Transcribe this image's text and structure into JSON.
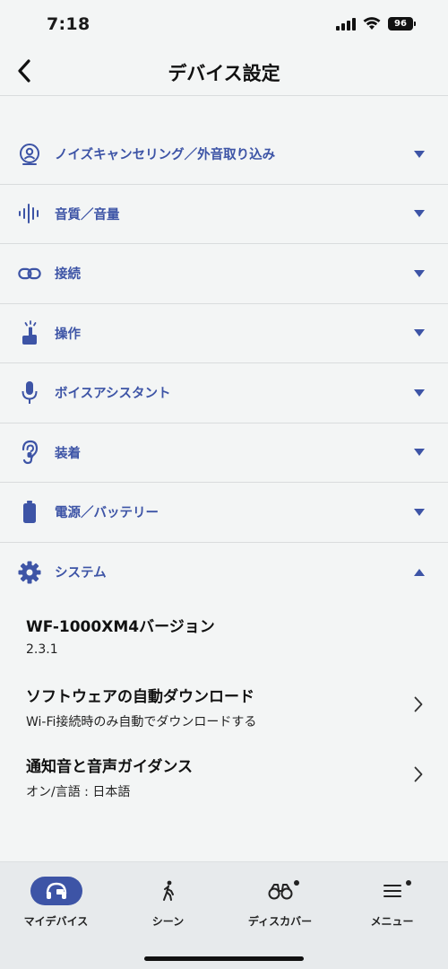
{
  "status_bar": {
    "time": "7:18",
    "battery": "96"
  },
  "header": {
    "title": "デバイス設定"
  },
  "sections": [
    {
      "label": "ノイズキャンセリング／外音取り込み",
      "icon": "ear-person-icon",
      "expanded": false
    },
    {
      "label": "音質／音量",
      "icon": "sound-wave-icon",
      "expanded": false
    },
    {
      "label": "接続",
      "icon": "link-icon",
      "expanded": false
    },
    {
      "label": "操作",
      "icon": "touch-icon",
      "expanded": false
    },
    {
      "label": "ボイスアシスタント",
      "icon": "microphone-icon",
      "expanded": false
    },
    {
      "label": "装着",
      "icon": "ear-icon",
      "expanded": false
    },
    {
      "label": "電源／バッテリー",
      "icon": "battery-icon",
      "expanded": false
    },
    {
      "label": "システム",
      "icon": "gear-icon",
      "expanded": true
    }
  ],
  "system": {
    "items": [
      {
        "title": "WF-1000XM4バージョン",
        "subtitle": "2.3.1"
      },
      {
        "title": "ソフトウェアの自動ダウンロード",
        "subtitle": "Wi-Fi接続時のみ自動でダウンロードする"
      },
      {
        "title": "通知音と音声ガイダンス",
        "subtitle": "オン/言語 : 日本語"
      }
    ]
  },
  "tabs": [
    {
      "label": "マイデバイス",
      "icon": "headphones-icon",
      "active": true
    },
    {
      "label": "シーン",
      "icon": "walking-person-icon",
      "active": false
    },
    {
      "label": "ディスカバー",
      "icon": "binoculars-icon",
      "active": false,
      "badge": true
    },
    {
      "label": "メニュー",
      "icon": "menu-icon",
      "active": false,
      "badge": true
    }
  ],
  "colors": {
    "accent": "#3d54a6",
    "background": "#f3f5f5",
    "tab_bar": "#e7eaec"
  }
}
